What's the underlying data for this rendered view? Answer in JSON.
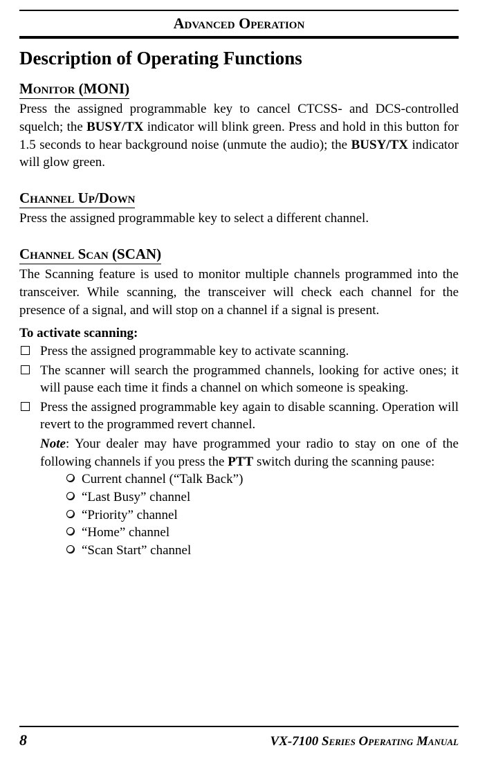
{
  "chapterTitle": "Advanced Operation",
  "heading1": "Description of Operating Functions",
  "monitor": {
    "heading": "Monitor (MONI)",
    "para_a": "Press the assigned programmable key to cancel CTCSS- and DCS-controlled squelch; the ",
    "busytx1": "BUSY/TX",
    "para_b": " indicator will blink green. Press and hold in this button for 1.5 seconds to hear background noise (unmute the audio); the ",
    "busytx2": "BUSY/TX",
    "para_c": " indicator will glow green."
  },
  "channelUpDown": {
    "heading": "Channel Up/Down",
    "para": "Press the assigned programmable key to select a different channel."
  },
  "channelScan": {
    "heading": "Channel Scan (SCAN)",
    "intro": "The Scanning feature is used to monitor multiple channels programmed into the transceiver. While scanning, the transceiver will check each channel for the presence of a signal, and will stop on a channel if a signal is present.",
    "activateLabel": "To activate scanning:",
    "li1": "Press the assigned programmable key to activate scanning.",
    "li2": "The scanner will search the programmed channels, looking for active ones; it will pause each time it finds a channel on which someone is speaking.",
    "li3": "Press the assigned programmable key again to disable scanning. Operation will revert to the programmed revert channel.",
    "noteLabel": "Note",
    "note_a": ": Your dealer may have programmed your radio to stay on one of the following channels if you press the ",
    "ptt": "PTT",
    "note_b": " switch during the scanning pause:",
    "circle": {
      "c1": "Current channel (“Talk Back”)",
      "c2": "“Last Busy” channel",
      "c3": "“Priority” channel",
      "c4": "“Home” channel",
      "c5": "“Scan Start” channel"
    }
  },
  "footer": {
    "pageNum": "8",
    "manualTitle": "VX-7100 Series Operating Manual"
  }
}
